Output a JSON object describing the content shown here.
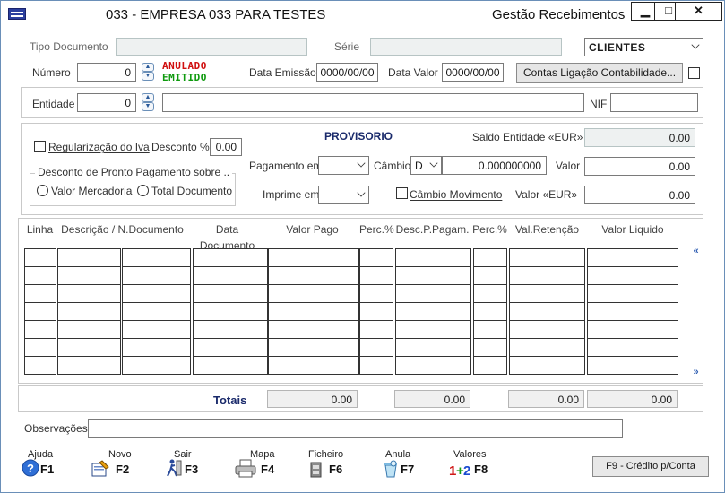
{
  "window": {
    "title": "033 - EMPRESA 033 PARA TESTES",
    "module": "Gestão Recebimentos",
    "minimize": "▁",
    "maximize": "□",
    "close": "✕"
  },
  "header": {
    "tipo_documento_label": "Tipo Documento",
    "tipo_documento_value": "",
    "serie_label": "Série",
    "serie_value": "",
    "tipo_select": "CLIENTES",
    "numero_label": "Número",
    "numero_value": "0",
    "status_anulado": "ANULADO",
    "status_emitido": "EMITIDO",
    "data_emissao_label": "Data Emissão",
    "data_emissao_value": "0000/00/00",
    "data_valor_label": "Data Valor",
    "data_valor_value": "0000/00/00",
    "contas_button": "Contas Ligação Contabilidade...",
    "entidade_label": "Entidade",
    "entidade_value": "0",
    "entidade_nome": "",
    "nif_label": "NIF",
    "nif_value": ""
  },
  "options": {
    "regularizacao_label": "Regularização do Iva",
    "desconto_label": "Desconto %",
    "desconto_value": "0.00",
    "pronto_pagamento_title": "Desconto de Pronto Pagamento sobre ..",
    "radio_valor_mercadoria": "Valor Mercadoria",
    "radio_total_documento": "Total Documento",
    "provisorio": "PROVISORIO",
    "pagamento_em_label": "Pagamento em",
    "pagamento_em_value": "",
    "cambio_label": "Câmbio",
    "cambio_code": "D",
    "cambio_value": "0.000000000",
    "imprime_em_label": "Imprime em:",
    "imprime_em_value": "",
    "cambio_movimento_label": "Câmbio Movimento",
    "saldo_entidade_label": "Saldo Entidade  «EUR»",
    "saldo_entidade_value": "0.00",
    "valor_label": "Valor",
    "valor_value": "0.00",
    "valor_eur_label": "Valor  «EUR»",
    "valor_eur_value": "0.00"
  },
  "grid": {
    "columns": [
      "Linha",
      "Descrição / N.Documento",
      "Data Documento",
      "Valor Pago",
      "Perc.%",
      "Desc.P.Pagam.",
      "Perc.%",
      "Val.Retenção",
      "Valor Liquido"
    ],
    "scroll_up": "«",
    "scroll_down": "»"
  },
  "totals": {
    "label": "Totais",
    "valor_pago": "0.00",
    "desc_p_pagam": "0.00",
    "val_retencao": "0.00",
    "valor_liquido": "0.00"
  },
  "observacoes": {
    "label": "Observações:",
    "value": ""
  },
  "toolbar": [
    {
      "label": "Ajuda",
      "key": "F1"
    },
    {
      "label": "Novo",
      "key": "F2"
    },
    {
      "label": "Sair",
      "key": "F3"
    },
    {
      "label": "Mapa",
      "key": "F4"
    },
    {
      "label": "Ficheiro",
      "key": "F6"
    },
    {
      "label": "Anula",
      "key": "F7"
    },
    {
      "label": "Valores",
      "key": "F8"
    }
  ],
  "credit_button": "F9 - Crédito p/Conta"
}
